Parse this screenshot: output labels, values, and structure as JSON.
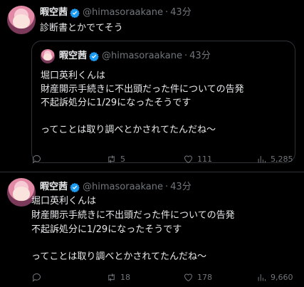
{
  "tweet1": {
    "name": "暇空茜",
    "handle": "@himasoraakane",
    "dot": "·",
    "time": "43分",
    "text": "診断書とかでてそう",
    "quote": {
      "name": "暇空茜",
      "handle": "@himasoraakane",
      "dot": "·",
      "time": "43分",
      "lines": [
        "堀口英利くんは",
        "財産開示手続きに不出頭だった件についての告発",
        "不起訴処分に1/29になったそうです",
        "",
        "ってことは取り調べとかされてたんだね〜"
      ]
    },
    "actions": {
      "replies": "",
      "retweets": "5",
      "likes": "111",
      "views": "5,285"
    }
  },
  "tweet2": {
    "name": "暇空茜",
    "handle": "@himasoraakane",
    "dot": "·",
    "time": "43分",
    "lines": [
      "堀口英利くんは",
      "財産開示手続きに不出頭だった件についての告発",
      "不起訴処分に1/29になったそうです",
      "",
      "ってことは取り調べとかされてたんだね〜"
    ],
    "actions": {
      "replies": "",
      "retweets": "18",
      "likes": "178",
      "views": "9,660"
    }
  },
  "colors": {
    "background": "#000000",
    "text": "#e7e9ea",
    "muted": "#71767b",
    "border": "#2f3336",
    "verified": "#1d9bf0"
  }
}
